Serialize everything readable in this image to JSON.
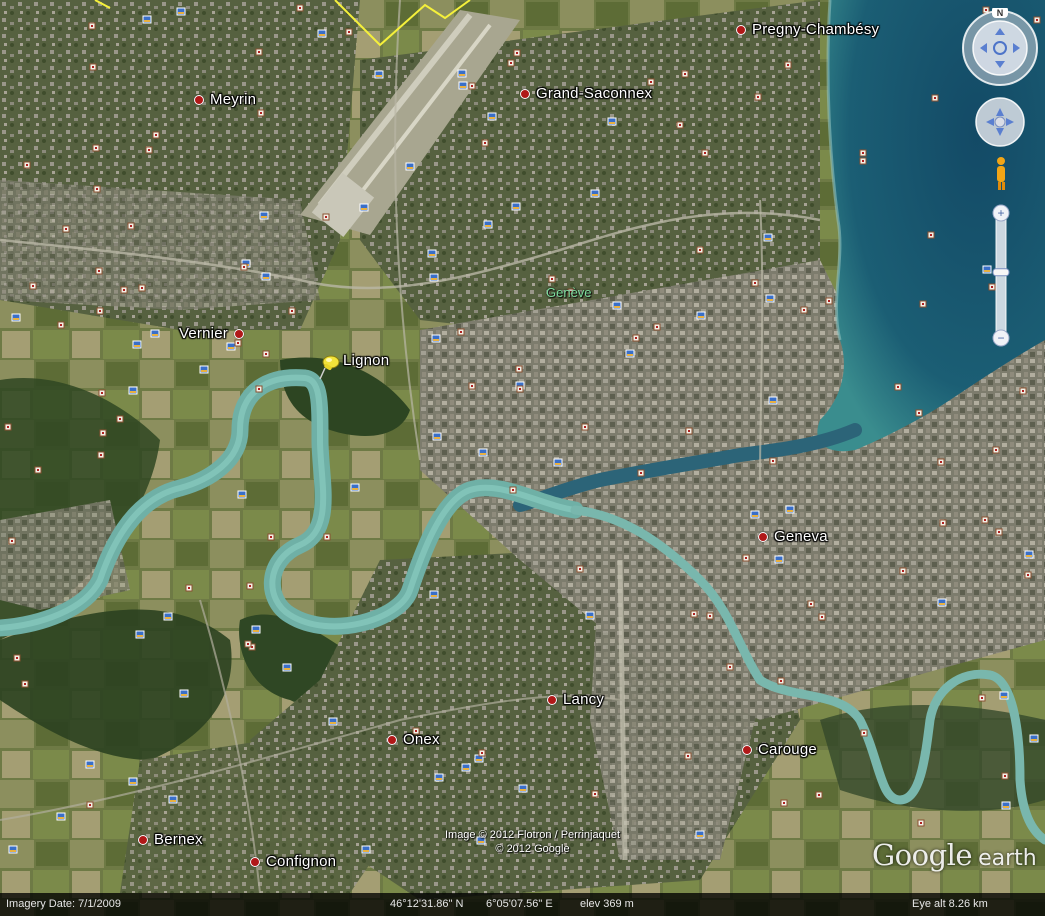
{
  "places": [
    {
      "id": "pregny-chambesy",
      "label": "Pregny-Chambésy"
    },
    {
      "id": "grand-saconnex",
      "label": "Grand-Saconnex"
    },
    {
      "id": "meyrin",
      "label": "Meyrin"
    },
    {
      "id": "vernier",
      "label": "Vernier"
    },
    {
      "id": "lignon",
      "label": "Lignon"
    },
    {
      "id": "geneva",
      "label": "Geneva"
    },
    {
      "id": "lancy",
      "label": "Lancy"
    },
    {
      "id": "onex",
      "label": "Onex"
    },
    {
      "id": "carouge",
      "label": "Carouge"
    },
    {
      "id": "bernex",
      "label": "Bernex"
    },
    {
      "id": "confignon",
      "label": "Confignon"
    }
  ],
  "region_label": "Genève",
  "copyright": {
    "line1": "Image © 2012 Flotron / Perrinjaquet",
    "line2": "© 2012 Google"
  },
  "logo": {
    "word1": "Google",
    "word2": "earth"
  },
  "status": {
    "imagery_date": "Imagery Date: 7/1/2009",
    "latitude": "46°12'31.86\" N",
    "longitude": "6°05'07.56\" E",
    "elevation": "elev   369 m",
    "eye_alt": "Eye alt    8.26 km"
  },
  "nav": {
    "north_label": "N",
    "zoom_in": "+",
    "zoom_out": "−",
    "zoom_level": 0.45
  },
  "colors": {
    "lake": "#1d5f77",
    "river": "#6fb0a6",
    "urban": "#8a8a78",
    "farmland": "#7f8756",
    "forest": "#2c4220",
    "pin": "#f2e33a",
    "place_dot": "#b01818",
    "boundary": "#f5f03b"
  }
}
